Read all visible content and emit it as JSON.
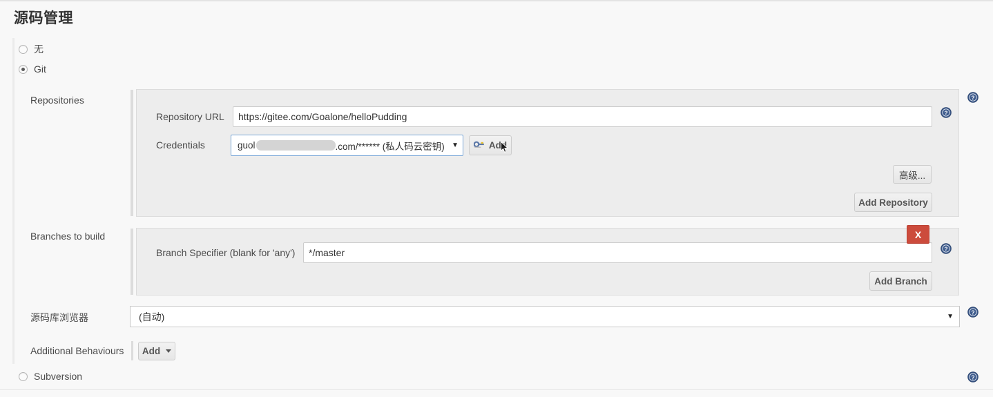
{
  "page": {
    "title": "源码管理"
  },
  "scm_options": [
    {
      "label": "无",
      "selected": false,
      "name": "none"
    },
    {
      "label": "Git",
      "selected": true,
      "name": "git"
    },
    {
      "label": "Subversion",
      "selected": false,
      "name": "subversion"
    }
  ],
  "sections": {
    "repositories": {
      "label": "Repositories",
      "repository_url": {
        "label": "Repository URL",
        "value": "https://gitee.com/Goalone/helloPudding",
        "placeholder": ""
      },
      "credentials": {
        "label": "Credentials",
        "value_prefix": "guol",
        "value_suffix": ".com/****** (私人码云密钥)",
        "caret": "▼",
        "add_button": "Add",
        "add_icon": "key-icon"
      },
      "advanced_button": "高级...",
      "add_repository_button": "Add Repository"
    },
    "branches": {
      "label": "Branches to build",
      "branch_specifier": {
        "label": "Branch Specifier (blank for 'any')",
        "value": "*/master",
        "placeholder": ""
      },
      "delete_button": "X",
      "add_branch_button": "Add Branch"
    },
    "repository_browser": {
      "label": "源码库浏览器",
      "value": "(自动)",
      "caret": "▼"
    },
    "additional_behaviours": {
      "label": "Additional Behaviours",
      "add_button": "Add",
      "caret": "▾"
    }
  },
  "help_icons": {
    "label": "?"
  },
  "colors": {
    "panel_bg": "#ededed",
    "page_bg": "#f8f8f8",
    "danger": "#cc4b3c",
    "help_blue": "#3c5a8c",
    "focus_blue": "#7aa7d8"
  }
}
